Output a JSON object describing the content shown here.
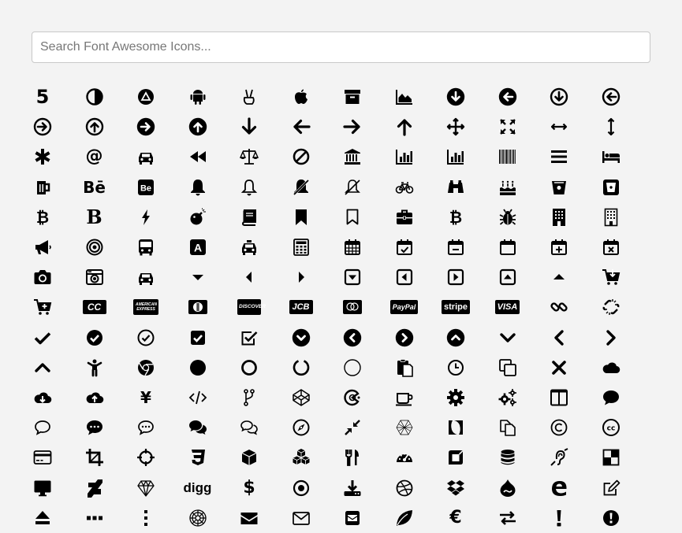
{
  "search": {
    "placeholder": "Search Font Awesome Icons..."
  },
  "icons": [
    "500px-icon",
    "adjust-icon",
    "adn-icon",
    "android-icon",
    "angellist-icon",
    "apple-icon",
    "archive-icon",
    "area-chart-icon",
    "arrow-circle-down-icon",
    "arrow-circle-left-icon",
    "arrow-circle-o-down-icon",
    "arrow-circle-o-left-icon",
    "arrow-circle-o-right-icon",
    "arrow-circle-o-up-icon",
    "arrow-circle-right-icon",
    "arrow-circle-up-icon",
    "arrow-down-icon",
    "arrow-left-icon",
    "arrow-right-icon",
    "arrow-up-icon",
    "arrows-icon",
    "arrows-alt-icon",
    "arrows-h-icon",
    "arrows-v-icon",
    "asterisk-icon",
    "at-icon",
    "automobile-icon",
    "backward-icon",
    "balance-scale-icon",
    "ban-icon",
    "bank-icon",
    "bar-chart-icon",
    "bar-chart-o-icon",
    "barcode-icon",
    "bars-icon",
    "bed-icon",
    "beer-icon",
    "behance-icon",
    "behance-square-icon",
    "bell-icon",
    "bell-o-icon",
    "bell-slash-icon",
    "bell-slash-o-icon",
    "bicycle-icon",
    "binoculars-icon",
    "birthday-cake-icon",
    "bitbucket-icon",
    "bitbucket-square-icon",
    "bitcoin-icon",
    "bold-icon",
    "bolt-icon",
    "bomb-icon",
    "book-icon",
    "bookmark-icon",
    "bookmark-o-icon",
    "briefcase-icon",
    "btc-icon",
    "bug-icon",
    "building-icon",
    "building-o-icon",
    "bullhorn-icon",
    "bullseye-icon",
    "bus-icon",
    "buysellads-icon",
    "cab-icon",
    "calculator-icon",
    "calendar-icon",
    "calendar-check-o-icon",
    "calendar-minus-o-icon",
    "calendar-o-icon",
    "calendar-plus-o-icon",
    "calendar-times-o-icon",
    "camera-icon",
    "camera-retro-icon",
    "car-icon",
    "caret-down-icon",
    "caret-left-icon",
    "caret-right-icon",
    "caret-square-o-down-icon",
    "caret-square-o-left-icon",
    "caret-square-o-right-icon",
    "caret-square-o-up-icon",
    "caret-up-icon",
    "cart-arrow-down-icon",
    "cart-plus-icon",
    "cc-icon",
    "cc-amex-icon",
    "cc-diners-club-icon",
    "cc-discover-icon",
    "cc-jcb-icon",
    "cc-mastercard-icon",
    "cc-paypal-icon",
    "cc-stripe-icon",
    "cc-visa-icon",
    "chain-icon",
    "chain-broken-icon",
    "check-icon",
    "check-circle-icon",
    "check-circle-o-icon",
    "check-square-icon",
    "check-square-o-icon",
    "chevron-circle-down-icon",
    "chevron-circle-left-icon",
    "chevron-circle-right-icon",
    "chevron-circle-up-icon",
    "chevron-down-icon",
    "chevron-left-icon",
    "chevron-right-icon",
    "chevron-up-icon",
    "child-icon",
    "chrome-icon",
    "circle-icon",
    "circle-o-icon",
    "circle-o-notch-icon",
    "circle-thin-icon",
    "clipboard-icon",
    "clock-o-icon",
    "clone-icon",
    "close-icon",
    "cloud-icon",
    "cloud-download-icon",
    "cloud-upload-icon",
    "cny-icon",
    "code-icon",
    "code-fork-icon",
    "codepen-icon",
    "codiepie-icon",
    "coffee-icon",
    "cog-icon",
    "cogs-icon",
    "columns-icon",
    "comment-icon",
    "comment-o-icon",
    "commenting-icon",
    "commenting-o-icon",
    "comments-icon",
    "comments-o-icon",
    "compass-icon",
    "compress-icon",
    "connectdevelop-icon",
    "contao-icon",
    "copy-icon",
    "copyright-icon",
    "creative-commons-icon",
    "credit-card-icon",
    "crop-icon",
    "crosshairs-icon",
    "css3-icon",
    "cube-icon",
    "cubes-icon",
    "cutlery-icon",
    "dashboard-icon",
    "dashcube-icon",
    "database-icon",
    "deaf-icon",
    "delicious-icon",
    "desktop-icon",
    "deviantart-icon",
    "diamond-icon",
    "digg-icon",
    "dollar-icon",
    "dot-circle-o-icon",
    "download-icon",
    "dribbble-icon",
    "dropbox-icon",
    "drupal-icon",
    "edge-icon",
    "edit-icon",
    "eject-icon",
    "ellipsis-h-icon",
    "ellipsis-v-icon",
    "empire-icon",
    "envelope-icon",
    "envelope-o-icon",
    "envelope-square-icon",
    "envira-icon",
    "eur-icon",
    "exchange-icon",
    "exclamation-icon",
    "exclamation-circle-icon"
  ],
  "glyphs": {
    "bitcoin": "₿",
    "bold": "B",
    "at": "@",
    "cny": "¥",
    "dollar": "$",
    "euro": "€",
    "copyright": "©",
    "digg": "digg",
    "behance": "Bē",
    "behance_square": "Be",
    "cc": "CC",
    "amex": "AMERICAN EXPRESS",
    "discover": "DISCOVER",
    "jcb": "JCB",
    "paypal": "PayPal",
    "stripe": "stripe",
    "visa": "VISA",
    "buysellads": "A",
    "close": "✕"
  }
}
